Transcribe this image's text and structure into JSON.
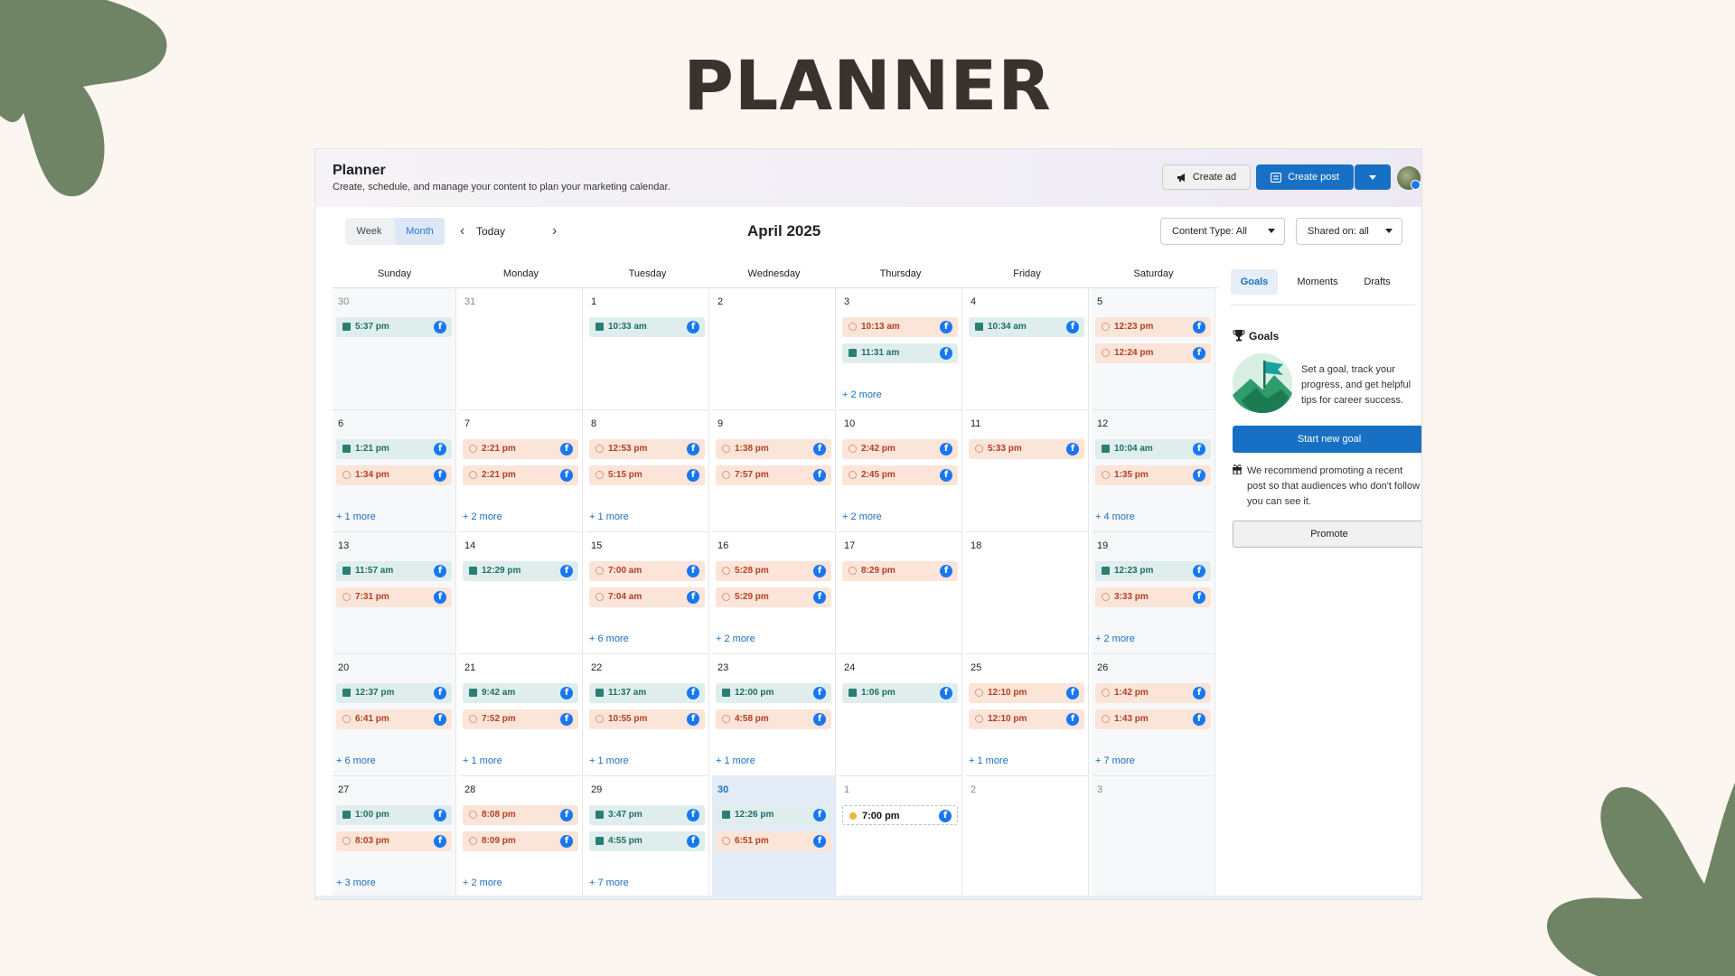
{
  "page": {
    "title": "PLANNER"
  },
  "colors": {
    "background": "#fbf6ef",
    "blob": "#6f8465",
    "primary": "#1870c4",
    "published_bg": "#dfeeec",
    "scheduled_bg": "#fbe4d8",
    "facebook": "#1877f2"
  },
  "header": {
    "title": "Planner",
    "subtitle": "Create, schedule, and manage your content to plan your marketing calendar.",
    "create_ad": "Create ad",
    "create_post": "Create post",
    "create_ad_icon": "megaphone-icon",
    "create_post_icon": "post-icon"
  },
  "toolbar": {
    "week": "Week",
    "month": "Month",
    "active_view": "Month",
    "prev_icon": "chevron-left-icon",
    "next_icon": "chevron-right-icon",
    "today": "Today",
    "month_label": "April 2025",
    "content_type": "Content Type: All",
    "shared_on": "Shared on: all"
  },
  "weekdays": [
    "Sunday",
    "Monday",
    "Tuesday",
    "Wednesday",
    "Thursday",
    "Friday",
    "Saturday"
  ],
  "calendar": {
    "weeks": [
      [
        {
          "day": "30",
          "muted": true,
          "events": [
            {
              "time": "5:37 pm",
              "type": "published"
            }
          ],
          "more": ""
        },
        {
          "day": "31",
          "muted": true,
          "events": [],
          "more": ""
        },
        {
          "day": "1",
          "events": [
            {
              "time": "10:33 am",
              "type": "published"
            }
          ],
          "more": ""
        },
        {
          "day": "2",
          "events": [],
          "more": ""
        },
        {
          "day": "3",
          "events": [
            {
              "time": "10:13 am",
              "type": "scheduled"
            },
            {
              "time": "11:31 am",
              "type": "published"
            }
          ],
          "more": "+ 2 more"
        },
        {
          "day": "4",
          "events": [
            {
              "time": "10:34 am",
              "type": "published"
            }
          ],
          "more": ""
        },
        {
          "day": "5",
          "events": [
            {
              "time": "12:23 pm",
              "type": "scheduled"
            },
            {
              "time": "12:24 pm",
              "type": "scheduled"
            }
          ],
          "more": ""
        }
      ],
      [
        {
          "day": "6",
          "events": [
            {
              "time": "1:21 pm",
              "type": "published"
            },
            {
              "time": "1:34 pm",
              "type": "scheduled"
            }
          ],
          "more": "+ 1 more"
        },
        {
          "day": "7",
          "events": [
            {
              "time": "2:21 pm",
              "type": "scheduled"
            },
            {
              "time": "2:21 pm",
              "type": "scheduled"
            }
          ],
          "more": "+ 2 more"
        },
        {
          "day": "8",
          "events": [
            {
              "time": "12:53 pm",
              "type": "scheduled"
            },
            {
              "time": "5:15 pm",
              "type": "scheduled"
            }
          ],
          "more": "+ 1 more"
        },
        {
          "day": "9",
          "events": [
            {
              "time": "1:38 pm",
              "type": "scheduled"
            },
            {
              "time": "7:57 pm",
              "type": "scheduled"
            }
          ],
          "more": ""
        },
        {
          "day": "10",
          "events": [
            {
              "time": "2:42 pm",
              "type": "scheduled"
            },
            {
              "time": "2:45 pm",
              "type": "scheduled"
            }
          ],
          "more": "+ 2 more"
        },
        {
          "day": "11",
          "events": [
            {
              "time": "5:33 pm",
              "type": "scheduled"
            }
          ],
          "more": ""
        },
        {
          "day": "12",
          "events": [
            {
              "time": "10:04 am",
              "type": "published"
            },
            {
              "time": "1:35 pm",
              "type": "scheduled"
            }
          ],
          "more": "+ 4 more"
        }
      ],
      [
        {
          "day": "13",
          "events": [
            {
              "time": "11:57 am",
              "type": "published"
            },
            {
              "time": "7:31 pm",
              "type": "scheduled"
            }
          ],
          "more": ""
        },
        {
          "day": "14",
          "events": [
            {
              "time": "12:29 pm",
              "type": "published"
            }
          ],
          "more": ""
        },
        {
          "day": "15",
          "events": [
            {
              "time": "7:00 am",
              "type": "scheduled"
            },
            {
              "time": "7:04 am",
              "type": "scheduled"
            }
          ],
          "more": "+ 6 more"
        },
        {
          "day": "16",
          "events": [
            {
              "time": "5:28 pm",
              "type": "scheduled"
            },
            {
              "time": "5:29 pm",
              "type": "scheduled"
            }
          ],
          "more": "+ 2 more"
        },
        {
          "day": "17",
          "events": [
            {
              "time": "8:29 pm",
              "type": "scheduled"
            }
          ],
          "more": ""
        },
        {
          "day": "18",
          "events": [],
          "more": ""
        },
        {
          "day": "19",
          "events": [
            {
              "time": "12:23 pm",
              "type": "published"
            },
            {
              "time": "3:33 pm",
              "type": "scheduled"
            }
          ],
          "more": "+ 2 more"
        }
      ],
      [
        {
          "day": "20",
          "events": [
            {
              "time": "12:37 pm",
              "type": "published"
            },
            {
              "time": "6:41 pm",
              "type": "scheduled"
            }
          ],
          "more": "+ 6 more"
        },
        {
          "day": "21",
          "events": [
            {
              "time": "9:42 am",
              "type": "published"
            },
            {
              "time": "7:52 pm",
              "type": "scheduled"
            }
          ],
          "more": "+ 1 more"
        },
        {
          "day": "22",
          "events": [
            {
              "time": "11:37 am",
              "type": "published"
            },
            {
              "time": "10:55 pm",
              "type": "scheduled"
            }
          ],
          "more": "+ 1 more"
        },
        {
          "day": "23",
          "events": [
            {
              "time": "12:00 pm",
              "type": "published"
            },
            {
              "time": "4:58 pm",
              "type": "scheduled"
            }
          ],
          "more": "+ 1 more"
        },
        {
          "day": "24",
          "events": [
            {
              "time": "1:06 pm",
              "type": "published"
            }
          ],
          "more": ""
        },
        {
          "day": "25",
          "events": [
            {
              "time": "12:10 pm",
              "type": "scheduled"
            },
            {
              "time": "12:10 pm",
              "type": "scheduled"
            }
          ],
          "more": "+ 1 more"
        },
        {
          "day": "26",
          "events": [
            {
              "time": "1:42 pm",
              "type": "scheduled"
            },
            {
              "time": "1:43 pm",
              "type": "scheduled"
            }
          ],
          "more": "+ 7 more"
        }
      ],
      [
        {
          "day": "27",
          "events": [
            {
              "time": "1:00 pm",
              "type": "published"
            },
            {
              "time": "8:03 pm",
              "type": "scheduled"
            }
          ],
          "more": "+ 3 more"
        },
        {
          "day": "28",
          "events": [
            {
              "time": "8:08 pm",
              "type": "scheduled"
            },
            {
              "time": "8:09 pm",
              "type": "scheduled"
            }
          ],
          "more": "+ 2 more"
        },
        {
          "day": "29",
          "events": [
            {
              "time": "3:47 pm",
              "type": "published"
            },
            {
              "time": "4:55 pm",
              "type": "published"
            }
          ],
          "more": "+ 7 more"
        },
        {
          "day": "30",
          "today": true,
          "events": [
            {
              "time": "12:26 pm",
              "type": "published"
            },
            {
              "time": "6:51 pm",
              "type": "scheduled"
            }
          ],
          "more": ""
        },
        {
          "day": "1",
          "muted": true,
          "events": [
            {
              "time": "7:00 pm",
              "type": "draft"
            }
          ],
          "more": ""
        },
        {
          "day": "2",
          "muted": true,
          "events": [],
          "more": ""
        },
        {
          "day": "3",
          "muted": true,
          "events": [],
          "more": ""
        }
      ]
    ]
  },
  "sidebar": {
    "tabs": [
      "Goals",
      "Moments",
      "Drafts"
    ],
    "active_tab": "Goals",
    "goals_heading": "Goals",
    "goal_text": "Set a goal, track your progress, and get helpful tips for career success.",
    "start_goal": "Start new goal",
    "recommend_text": "We recommend promoting a recent post so that audiences who don't follow you can see it.",
    "promote": "Promote"
  }
}
